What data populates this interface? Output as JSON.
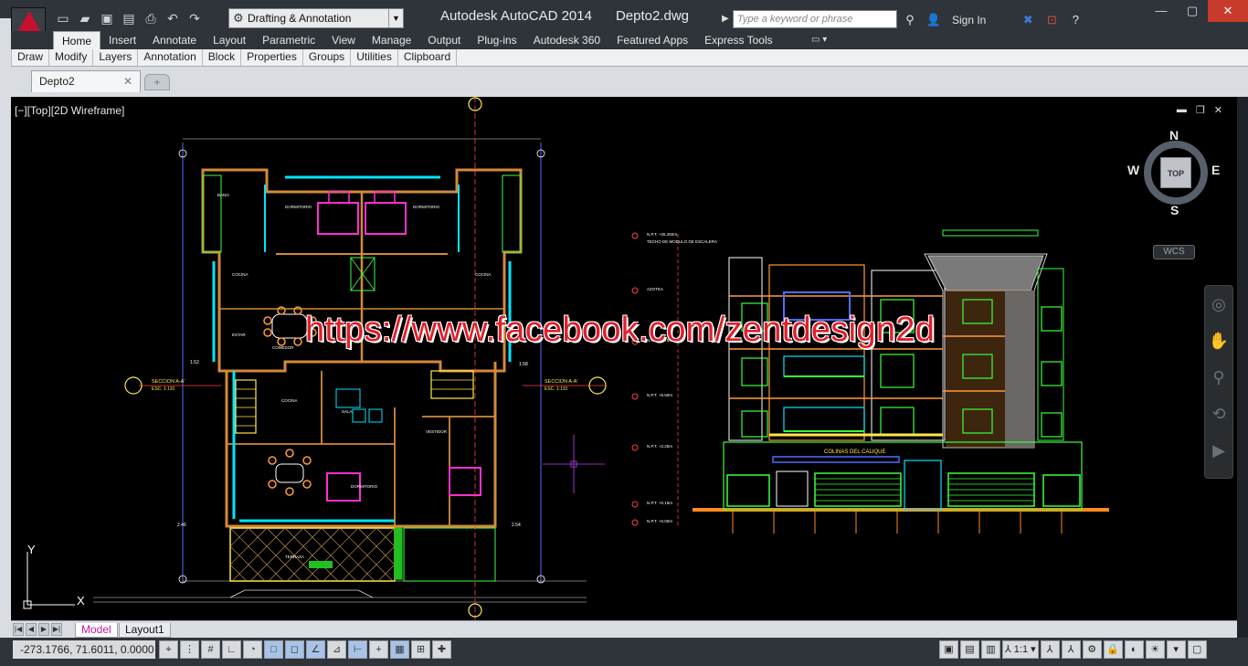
{
  "titlebar": {
    "app_name": "Autodesk AutoCAD 2014",
    "file_name": "Depto2.dwg",
    "workspace": "Drafting & Annotation",
    "search_placeholder": "Type a keyword or phrase",
    "sign_in": "Sign In"
  },
  "ribbon": {
    "tabs": [
      "Home",
      "Insert",
      "Annotate",
      "Layout",
      "Parametric",
      "View",
      "Manage",
      "Output",
      "Plug-ins",
      "Autodesk 360",
      "Featured Apps",
      "Express Tools"
    ],
    "panels": [
      "Draw",
      "Modify",
      "Layers",
      "Annotation",
      "Block",
      "Properties",
      "Groups",
      "Utilities",
      "Clipboard"
    ]
  },
  "document": {
    "tab_name": "Depto2",
    "viewport_label": "[−][Top][2D Wireframe]"
  },
  "viewcube": {
    "top": "TOP",
    "north": "N",
    "south": "S",
    "east": "E",
    "west": "W",
    "wcs": "WCS"
  },
  "drawing": {
    "watermark": "https://www.facebook.com/zentdesign2d",
    "elevation_sign": "COLINAS DEL CALIQUE",
    "section_left": "SECCION A-A'",
    "section_right": "SECCION A-A'",
    "scale_left": "ESC. 1:110",
    "scale_right": "ESC. 1:110",
    "dim_left_bottom": "2.46",
    "dim_right_bottom": "2.54",
    "dim_left_mid": "1.52",
    "dim_right_mid": "1.58",
    "level_1": "N.P.T. +25.250m",
    "level_1b": "TECHO DE MODULO DE ESCALERA",
    "level_2": "AZOTEA",
    "level_3": "N.P.T. +8.75m",
    "level_4": "N.P.T. +5.50m",
    "level_5": "N.P.T. +2.25m",
    "level_6": "N.P.T. +0.15m",
    "level_7": "N.P.T. +0.00m"
  },
  "layouts": {
    "model": "Model",
    "layout1": "Layout1"
  },
  "status": {
    "coordinates": "-273.1766, 71.6011, 0.0000",
    "annotation_scale": "1:1"
  }
}
